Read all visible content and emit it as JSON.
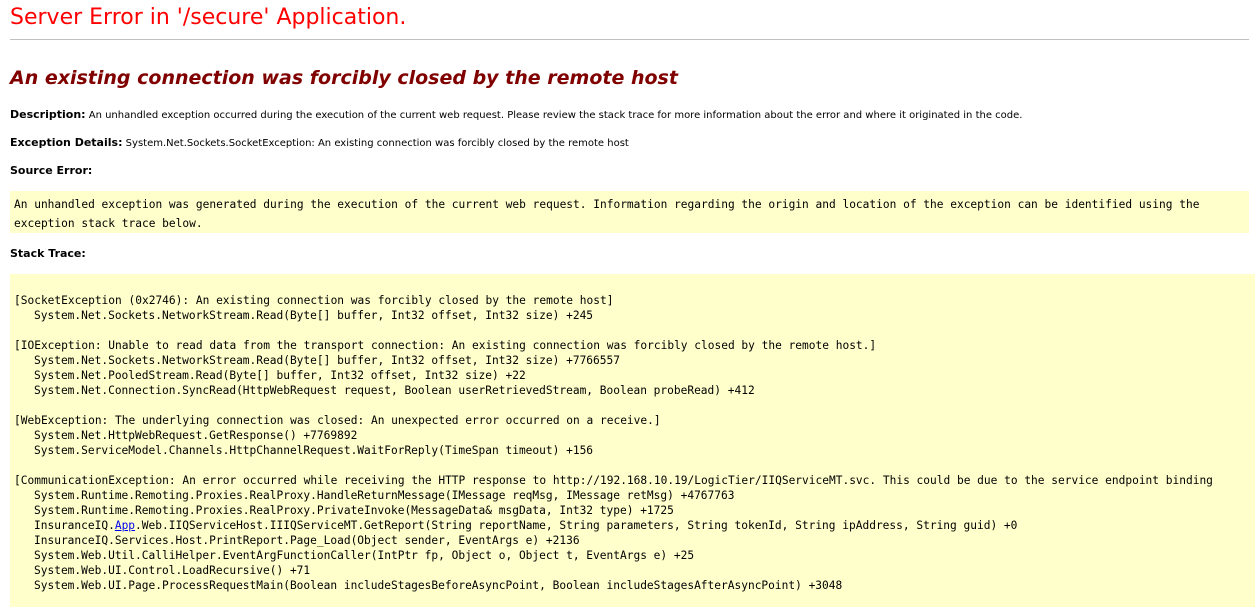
{
  "page": {
    "app_title": "Server Error in '/secure' Application.",
    "error_message": "An existing connection was forcibly closed by the remote host",
    "description_label": "Description:",
    "description_text": "An unhandled exception occurred during the execution of the current web request. Please review the stack trace for more information about the error and where it originated in the code.",
    "exception_label": "Exception Details:",
    "exception_text": "System.Net.Sockets.SocketException: An existing connection was forcibly closed by the remote host",
    "source_error_label": "Source Error:",
    "source_error_text": "An unhandled exception was generated during the execution of the current web request. Information regarding the origin and location of the exception can be identified using the exception stack trace below.",
    "stack_trace_label": "Stack Trace:"
  },
  "colors": {
    "title": "#ff0000",
    "error_message": "#800000",
    "code_background": "#ffffcc",
    "link": "#0000ee"
  },
  "stack_trace": [
    {
      "type": "header",
      "text": "[SocketException (0x2746): An existing connection was forcibly closed by the remote host]"
    },
    {
      "type": "frame",
      "text": "System.Net.Sockets.NetworkStream.Read(Byte[] buffer, Int32 offset, Int32 size) +245"
    },
    {
      "type": "blank",
      "text": ""
    },
    {
      "type": "header",
      "text": "[IOException: Unable to read data from the transport connection: An existing connection was forcibly closed by the remote host.]"
    },
    {
      "type": "frame",
      "text": "System.Net.Sockets.NetworkStream.Read(Byte[] buffer, Int32 offset, Int32 size) +7766557"
    },
    {
      "type": "frame",
      "text": "System.Net.PooledStream.Read(Byte[] buffer, Int32 offset, Int32 size) +22"
    },
    {
      "type": "frame",
      "text": "System.Net.Connection.SyncRead(HttpWebRequest request, Boolean userRetrievedStream, Boolean probeRead) +412"
    },
    {
      "type": "blank",
      "text": ""
    },
    {
      "type": "header",
      "text": "[WebException: The underlying connection was closed: An unexpected error occurred on a receive.]"
    },
    {
      "type": "frame",
      "text": "System.Net.HttpWebRequest.GetResponse() +7769892"
    },
    {
      "type": "frame",
      "text": "System.ServiceModel.Channels.HttpChannelRequest.WaitForReply(TimeSpan timeout) +156"
    },
    {
      "type": "blank",
      "text": ""
    },
    {
      "type": "header",
      "text": "[CommunicationException: An error occurred while receiving the HTTP response to http://192.168.10.19/LogicTier/IIQServiceMT.svc. This could be due to the service endpoint binding"
    },
    {
      "type": "frame",
      "text": "System.Runtime.Remoting.Proxies.RealProxy.HandleReturnMessage(IMessage reqMsg, IMessage retMsg) +4767763"
    },
    {
      "type": "frame",
      "text": "System.Runtime.Remoting.Proxies.RealProxy.PrivateInvoke(MessageData& msgData, Int32 type) +1725"
    },
    {
      "type": "frame",
      "pre": "InsuranceIQ.",
      "link": "App",
      "post": ".Web.IIQServiceHost.IIIQServiceMT.GetReport(String reportName, String parameters, String tokenId, String ipAddress, String guid) +0"
    },
    {
      "type": "frame",
      "text": "InsuranceIQ.Services.Host.PrintReport.Page_Load(Object sender, EventArgs e) +2136"
    },
    {
      "type": "frame",
      "text": "System.Web.Util.CalliHelper.EventArgFunctionCaller(IntPtr fp, Object o, Object t, EventArgs e) +25"
    },
    {
      "type": "frame",
      "text": "System.Web.UI.Control.LoadRecursive() +71"
    },
    {
      "type": "frame",
      "text": "System.Web.UI.Page.ProcessRequestMain(Boolean includeStagesBeforeAsyncPoint, Boolean includeStagesAfterAsyncPoint) +3048"
    }
  ]
}
